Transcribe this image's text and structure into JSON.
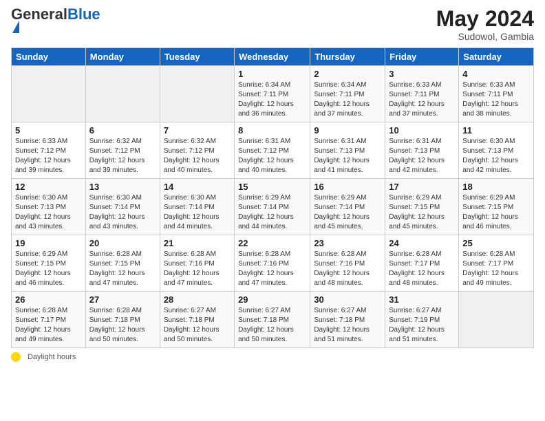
{
  "header": {
    "logo_general": "General",
    "logo_blue": "Blue",
    "month_year": "May 2024",
    "location": "Sudowol, Gambia"
  },
  "weekdays": [
    "Sunday",
    "Monday",
    "Tuesday",
    "Wednesday",
    "Thursday",
    "Friday",
    "Saturday"
  ],
  "weeks": [
    [
      {
        "day": "",
        "info": ""
      },
      {
        "day": "",
        "info": ""
      },
      {
        "day": "",
        "info": ""
      },
      {
        "day": "1",
        "info": "Sunrise: 6:34 AM\nSunset: 7:11 PM\nDaylight: 12 hours\nand 36 minutes."
      },
      {
        "day": "2",
        "info": "Sunrise: 6:34 AM\nSunset: 7:11 PM\nDaylight: 12 hours\nand 37 minutes."
      },
      {
        "day": "3",
        "info": "Sunrise: 6:33 AM\nSunset: 7:11 PM\nDaylight: 12 hours\nand 37 minutes."
      },
      {
        "day": "4",
        "info": "Sunrise: 6:33 AM\nSunset: 7:11 PM\nDaylight: 12 hours\nand 38 minutes."
      }
    ],
    [
      {
        "day": "5",
        "info": "Sunrise: 6:33 AM\nSunset: 7:12 PM\nDaylight: 12 hours\nand 39 minutes."
      },
      {
        "day": "6",
        "info": "Sunrise: 6:32 AM\nSunset: 7:12 PM\nDaylight: 12 hours\nand 39 minutes."
      },
      {
        "day": "7",
        "info": "Sunrise: 6:32 AM\nSunset: 7:12 PM\nDaylight: 12 hours\nand 40 minutes."
      },
      {
        "day": "8",
        "info": "Sunrise: 6:31 AM\nSunset: 7:12 PM\nDaylight: 12 hours\nand 40 minutes."
      },
      {
        "day": "9",
        "info": "Sunrise: 6:31 AM\nSunset: 7:13 PM\nDaylight: 12 hours\nand 41 minutes."
      },
      {
        "day": "10",
        "info": "Sunrise: 6:31 AM\nSunset: 7:13 PM\nDaylight: 12 hours\nand 42 minutes."
      },
      {
        "day": "11",
        "info": "Sunrise: 6:30 AM\nSunset: 7:13 PM\nDaylight: 12 hours\nand 42 minutes."
      }
    ],
    [
      {
        "day": "12",
        "info": "Sunrise: 6:30 AM\nSunset: 7:13 PM\nDaylight: 12 hours\nand 43 minutes."
      },
      {
        "day": "13",
        "info": "Sunrise: 6:30 AM\nSunset: 7:14 PM\nDaylight: 12 hours\nand 43 minutes."
      },
      {
        "day": "14",
        "info": "Sunrise: 6:30 AM\nSunset: 7:14 PM\nDaylight: 12 hours\nand 44 minutes."
      },
      {
        "day": "15",
        "info": "Sunrise: 6:29 AM\nSunset: 7:14 PM\nDaylight: 12 hours\nand 44 minutes."
      },
      {
        "day": "16",
        "info": "Sunrise: 6:29 AM\nSunset: 7:14 PM\nDaylight: 12 hours\nand 45 minutes."
      },
      {
        "day": "17",
        "info": "Sunrise: 6:29 AM\nSunset: 7:15 PM\nDaylight: 12 hours\nand 45 minutes."
      },
      {
        "day": "18",
        "info": "Sunrise: 6:29 AM\nSunset: 7:15 PM\nDaylight: 12 hours\nand 46 minutes."
      }
    ],
    [
      {
        "day": "19",
        "info": "Sunrise: 6:29 AM\nSunset: 7:15 PM\nDaylight: 12 hours\nand 46 minutes."
      },
      {
        "day": "20",
        "info": "Sunrise: 6:28 AM\nSunset: 7:15 PM\nDaylight: 12 hours\nand 47 minutes."
      },
      {
        "day": "21",
        "info": "Sunrise: 6:28 AM\nSunset: 7:16 PM\nDaylight: 12 hours\nand 47 minutes."
      },
      {
        "day": "22",
        "info": "Sunrise: 6:28 AM\nSunset: 7:16 PM\nDaylight: 12 hours\nand 47 minutes."
      },
      {
        "day": "23",
        "info": "Sunrise: 6:28 AM\nSunset: 7:16 PM\nDaylight: 12 hours\nand 48 minutes."
      },
      {
        "day": "24",
        "info": "Sunrise: 6:28 AM\nSunset: 7:17 PM\nDaylight: 12 hours\nand 48 minutes."
      },
      {
        "day": "25",
        "info": "Sunrise: 6:28 AM\nSunset: 7:17 PM\nDaylight: 12 hours\nand 49 minutes."
      }
    ],
    [
      {
        "day": "26",
        "info": "Sunrise: 6:28 AM\nSunset: 7:17 PM\nDaylight: 12 hours\nand 49 minutes."
      },
      {
        "day": "27",
        "info": "Sunrise: 6:28 AM\nSunset: 7:18 PM\nDaylight: 12 hours\nand 50 minutes."
      },
      {
        "day": "28",
        "info": "Sunrise: 6:27 AM\nSunset: 7:18 PM\nDaylight: 12 hours\nand 50 minutes."
      },
      {
        "day": "29",
        "info": "Sunrise: 6:27 AM\nSunset: 7:18 PM\nDaylight: 12 hours\nand 50 minutes."
      },
      {
        "day": "30",
        "info": "Sunrise: 6:27 AM\nSunset: 7:18 PM\nDaylight: 12 hours\nand 51 minutes."
      },
      {
        "day": "31",
        "info": "Sunrise: 6:27 AM\nSunset: 7:19 PM\nDaylight: 12 hours\nand 51 minutes."
      },
      {
        "day": "",
        "info": ""
      }
    ]
  ],
  "footer": {
    "daylight_label": "Daylight hours"
  }
}
